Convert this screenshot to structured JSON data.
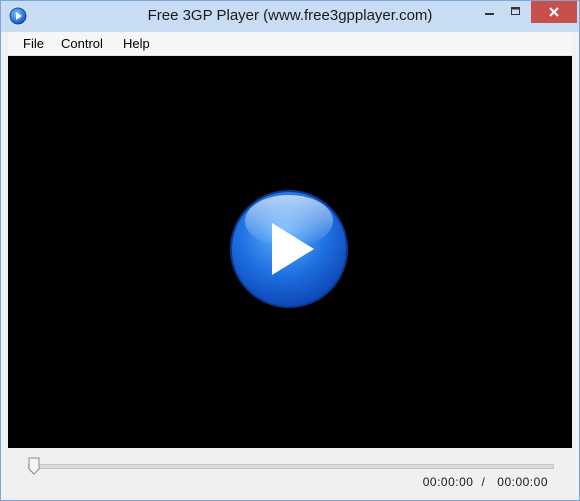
{
  "window": {
    "title": "Free 3GP Player (www.free3gpplayer.com)"
  },
  "menu": {
    "items": [
      {
        "label": "File"
      },
      {
        "label": "Control"
      },
      {
        "label": "Help"
      }
    ]
  },
  "player": {
    "state": "stopped",
    "center_icon": "play-icon",
    "progress_fraction": 0.0
  },
  "time": {
    "current": "00:00:00",
    "separator": "/",
    "total": "00:00:00"
  },
  "colors": {
    "title_bar": "#c8dcf3",
    "close_button": "#c7504d",
    "video_bg": "#000000",
    "play_button": "#1e6fe0"
  }
}
